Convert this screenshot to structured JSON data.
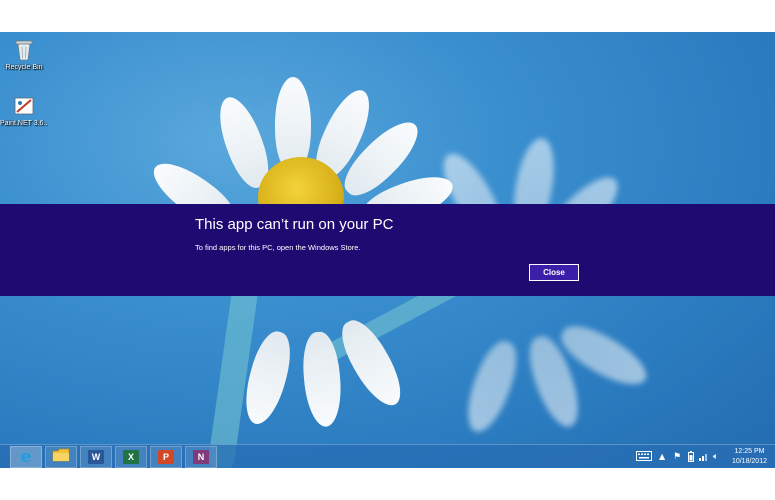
{
  "desktop": {
    "icons": [
      {
        "label": "Recycle Bin",
        "icon": "recycle-bin-icon"
      },
      {
        "label": "Paint.NET 3.6...",
        "icon": "paint-net-icon"
      }
    ]
  },
  "dialog": {
    "title": "This app can’t run on your PC",
    "message": "To find apps for this PC, open the Windows Store.",
    "close_label": "Close",
    "background_color": "#1e0b72"
  },
  "taskbar": {
    "apps": [
      {
        "name": "Internet Explorer",
        "icon": "internet-explorer-icon",
        "glyph": "e",
        "color": "#1a9fe0"
      },
      {
        "name": "File Explorer",
        "icon": "folder-icon",
        "glyph": "",
        "color": "#f2c23a"
      },
      {
        "name": "Word",
        "icon": "word-icon",
        "glyph": "W",
        "color": "#2b579a"
      },
      {
        "name": "Excel",
        "icon": "excel-icon",
        "glyph": "X",
        "color": "#217346"
      },
      {
        "name": "PowerPoint",
        "icon": "powerpoint-icon",
        "glyph": "P",
        "color": "#d24726"
      },
      {
        "name": "OneNote",
        "icon": "onenote-icon",
        "glyph": "N",
        "color": "#80397b"
      }
    ],
    "tray": {
      "icons": [
        "keyboard-icon",
        "chevron-up-icon",
        "flag-icon",
        "battery-icon",
        "network-icon",
        "volume-icon"
      ]
    },
    "clock": {
      "time": "12:25 PM",
      "date": "10/18/2012"
    }
  }
}
